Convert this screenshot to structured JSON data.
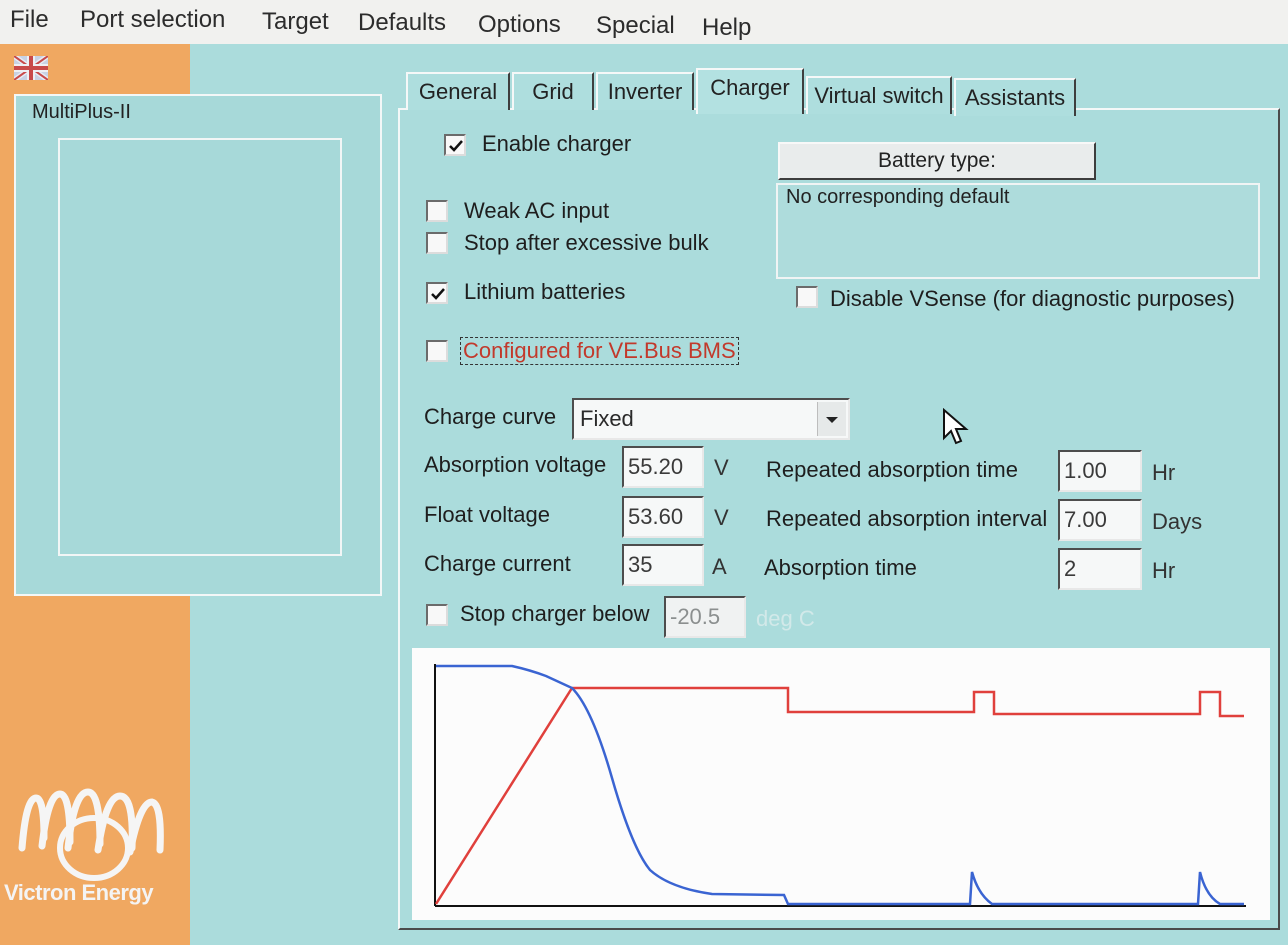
{
  "menu": [
    "File",
    "Port selection",
    "Target",
    "Defaults",
    "Options",
    "Special",
    "Help"
  ],
  "device": {
    "name": "MultiPlus-II"
  },
  "brand": {
    "logo_text": "Victron Energy"
  },
  "tabs": [
    {
      "label": "General",
      "active": false
    },
    {
      "label": "Grid",
      "active": false
    },
    {
      "label": "Inverter",
      "active": false
    },
    {
      "label": "Charger",
      "active": true
    },
    {
      "label": "Virtual switch",
      "active": false
    },
    {
      "label": "Assistants",
      "active": false
    }
  ],
  "charger": {
    "enable_charger": {
      "label": "Enable charger",
      "checked": true
    },
    "weak_ac": {
      "label": "Weak AC input",
      "checked": false
    },
    "stop_bulk": {
      "label": "Stop after excessive bulk",
      "checked": false
    },
    "lithium": {
      "label": "Lithium batteries",
      "checked": true
    },
    "vebus_bms": {
      "label": "Configured for VE.Bus BMS",
      "checked": false
    },
    "disable_vsense": {
      "label": "Disable VSense (for diagnostic purposes)",
      "checked": false
    },
    "battery_type_button": "Battery type:",
    "battery_type_text": "No corresponding default",
    "charge_curve": {
      "label": "Charge curve",
      "value": "Fixed"
    },
    "absorption_voltage": {
      "label": "Absorption voltage",
      "value": "55.20",
      "unit": "V"
    },
    "float_voltage": {
      "label": "Float voltage",
      "value": "53.60",
      "unit": "V"
    },
    "charge_current": {
      "label": "Charge current",
      "value": "35",
      "unit": "A"
    },
    "repeated_absorption_time": {
      "label": "Repeated absorption time",
      "value": "1.00",
      "unit": "Hr"
    },
    "repeated_absorption_interval": {
      "label": "Repeated absorption interval",
      "value": "7.00",
      "unit": "Days"
    },
    "absorption_time": {
      "label": "Absorption time",
      "value": "2",
      "unit": "Hr"
    },
    "stop_charger_below": {
      "label": "Stop charger below",
      "checked": false,
      "value": "-20.5",
      "unit": "deg C"
    }
  },
  "colors": {
    "voltage_curve": "#e0403c",
    "current_curve": "#3a64d2",
    "left_panel": "#f0a861",
    "background": "#abdcdc"
  }
}
